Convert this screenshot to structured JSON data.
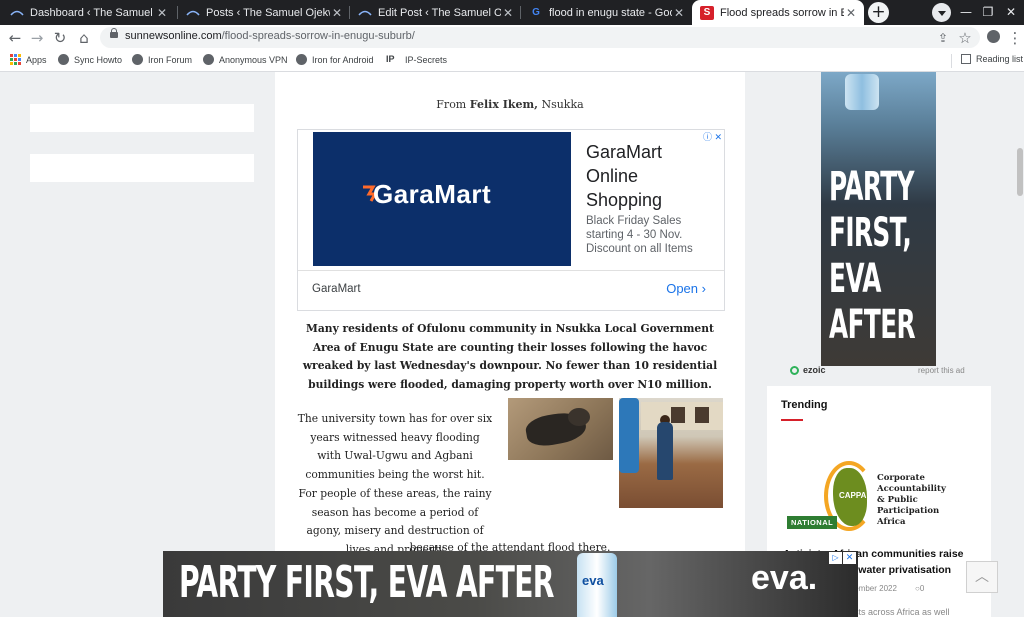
{
  "browser": {
    "tabs": [
      {
        "title": "Dashboard ‹ The Samuel Ojekwe",
        "icon": "blogger-icon"
      },
      {
        "title": "Posts ‹ The Samuel Ojekwe Blog",
        "icon": "blogger-icon"
      },
      {
        "title": "Edit Post ‹ The Samuel Ojekwe Bl",
        "icon": "blogger-icon"
      },
      {
        "title": "flood in enugu state - Google Se",
        "icon": "google-icon"
      },
      {
        "title": "Flood spreads sorrow in Enugu s",
        "icon": "sun-news-icon",
        "active": true
      }
    ],
    "close_glyph": "✕",
    "new_tab_glyph": "+",
    "url_host": "sunnewsonline.com",
    "url_path": "/flood-spreads-sorrow-in-enugu-suburb/",
    "bookmarks": [
      {
        "label": "Apps",
        "icon": "apps-grid-icon"
      },
      {
        "label": "Sync Howto",
        "icon": "globe-icon"
      },
      {
        "label": "Iron Forum",
        "icon": "globe-icon"
      },
      {
        "label": "Anonymous VPN",
        "icon": "globe-icon"
      },
      {
        "label": "Iron for Android",
        "icon": "globe-icon"
      },
      {
        "label": "IP-Secrets",
        "icon": "ip-icon"
      }
    ],
    "reading_list": "Reading list"
  },
  "article": {
    "byline_prefix": "From",
    "byline_author": "Felix Ikem,",
    "byline_place": "Nsukka",
    "lead": "Many residents of Ofulonu community in Nsukka Local Government Area of Enugu State are counting their losses following the havoc wreaked by last Wednesday's downpour. No fewer than 10 residential buildings were flooded, damaging property worth over N10 million.",
    "body": "The university town has for over six years witnessed heavy flooding with Uwal-Ugwu and Agbani communities being the worst hit. For people of these areas, the rainy season has become a period of agony, misery and destruction of lives and property",
    "body_tail": "because of the attendant flood there."
  },
  "garamart_ad": {
    "logo_text": "GaraMart",
    "headline": "GaraMart Online Shopping",
    "description": "Black Friday Sales starting 4 - 30 Nov. Discount on all Items",
    "brand": "GaraMart",
    "cta": "Open",
    "cta_glyph": "›",
    "adchoices": "ⓘ ✕"
  },
  "side_ad": {
    "slogan": "PARTY FIRST, EVA AFTER",
    "slogan_lines": [
      "PARTY",
      "FIRST,",
      "EVA",
      "AFTER"
    ],
    "provider": "ezoic",
    "report": "report this ad"
  },
  "trending": {
    "heading": "Trending",
    "logo_tag": "CAPPA",
    "logo_words": "Corporate Accountability & Public Participation Africa",
    "badge": "NATIONAL",
    "title": "Activists, African communities raise voices against water privatisation",
    "date": "November 2022",
    "comments": "0",
    "excerpt": "...vists across Africa as well"
  },
  "bottom_ad": {
    "slogan": "PARTY FIRST, EVA AFTER",
    "bottle_label": "eva",
    "brand": "eva."
  },
  "back_to_top_glyph": "︿"
}
